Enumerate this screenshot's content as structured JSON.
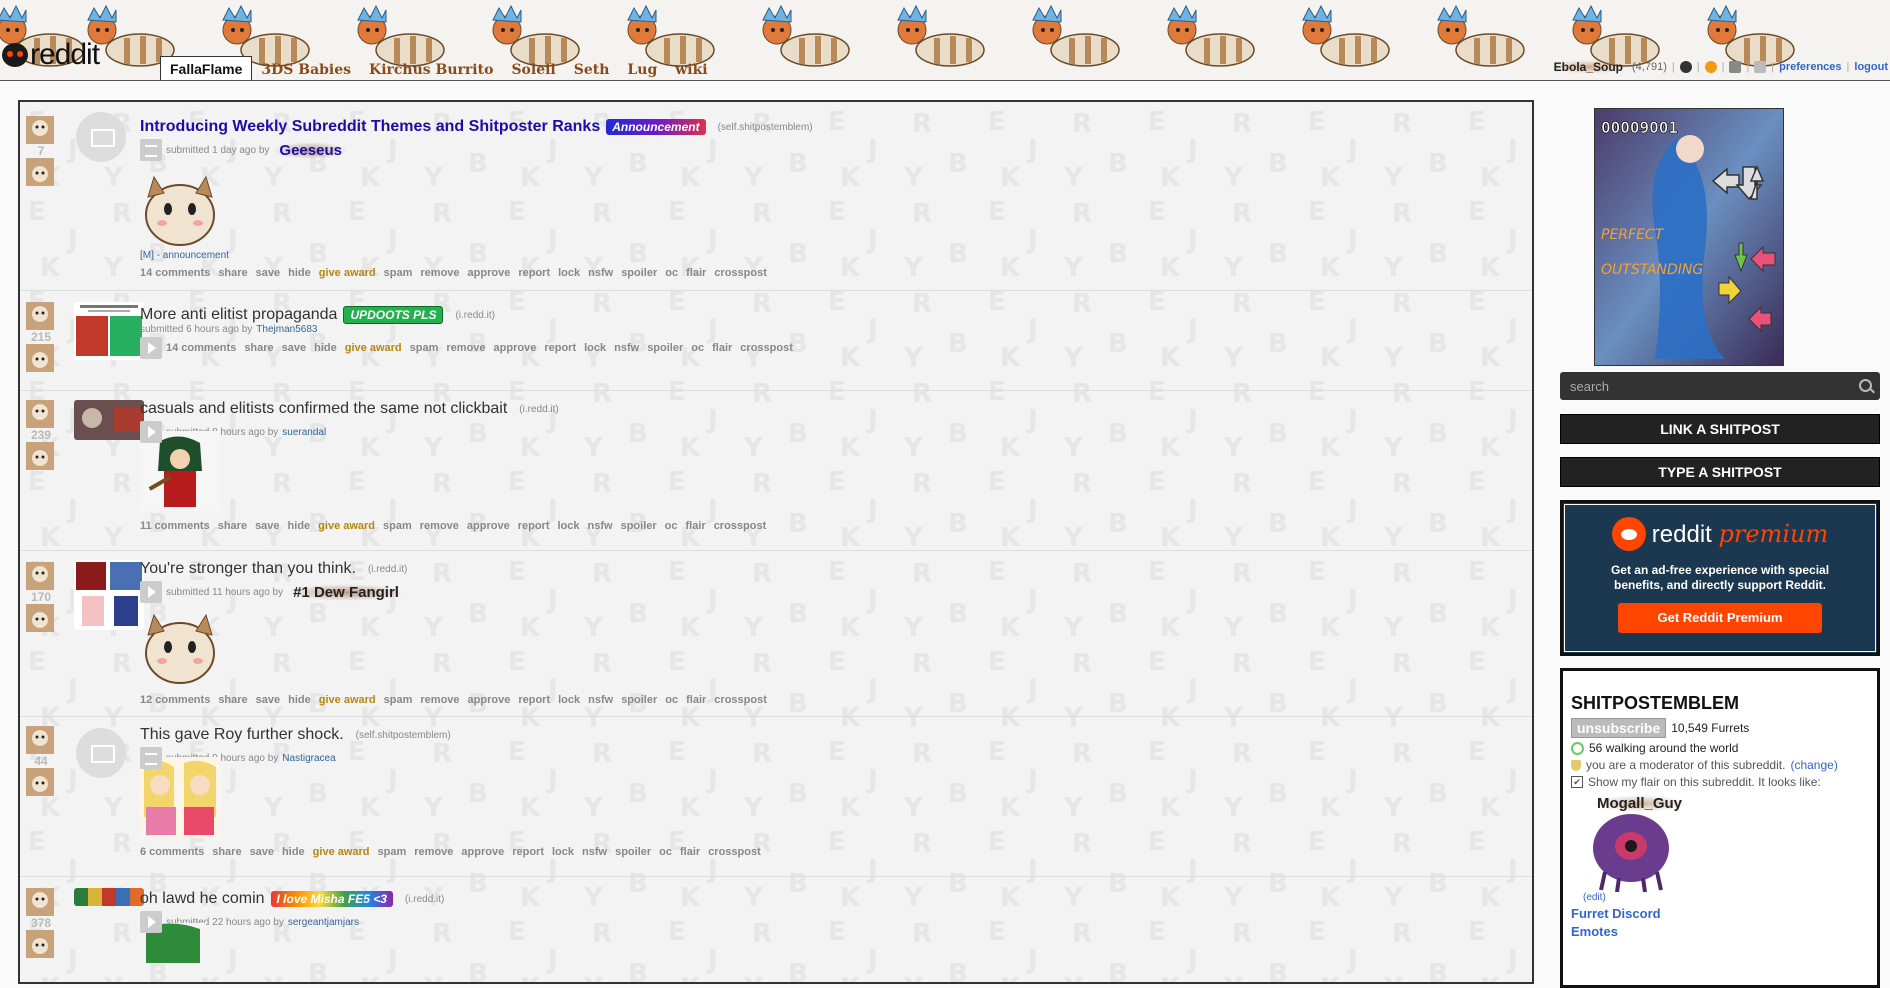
{
  "header": {
    "logo_text": "reddit",
    "tabs": [
      "FallaFlame",
      "3DS Babies",
      "Kirchus Burrito",
      "Soleil",
      "Seth",
      "Lug",
      "wiki"
    ],
    "user": {
      "name": "Ebola_Soup",
      "karma": "(4,791)",
      "preferences": "preferences",
      "logout": "logout"
    }
  },
  "posts": [
    {
      "score": "7",
      "title": "Introducing Weekly Subreddit Themes and Shitposter Ranks",
      "flair": "Announcement",
      "domain": "(self.shitpostemblem)",
      "submitted": "submitted 1 day ago by",
      "author": "Geeseus",
      "link_flair": "[M] - announcement",
      "comments": "14 comments"
    },
    {
      "score": "215",
      "title": "More anti elitist propaganda",
      "flair": "UPDOOTS PLS",
      "domain": "(i.redd.it)",
      "submitted": "submitted 6 hours ago by",
      "author": "Thejman5683",
      "comments": "14 comments"
    },
    {
      "score": "239",
      "title": "casuals and elitists confirmed the same not clickbait",
      "domain": "(i.redd.it)",
      "submitted": "submitted 8 hours ago by",
      "author": "suerandal",
      "comments": "11 comments"
    },
    {
      "score": "170",
      "title": "You're stronger than you think.",
      "domain": "(i.redd.it)",
      "submitted": "submitted 11 hours ago by",
      "author": "#1 Dew Fangirl",
      "comments": "12 comments"
    },
    {
      "score": "44",
      "title": "This gave Roy further shock.",
      "domain": "(self.shitpostemblem)",
      "submitted": "submitted 9 hours ago by",
      "author": "Nastigracea",
      "comments": "6 comments"
    },
    {
      "score": "378",
      "title": "oh lawd he comin",
      "flair": "I love Misha FE5 <3",
      "domain": "(i.redd.it)",
      "submitted": "submitted 22 hours ago by",
      "author": "sergeantjamjars"
    }
  ],
  "actions": {
    "share": "share",
    "save": "save",
    "hide": "hide",
    "give_award": "give award",
    "spam": "spam",
    "remove": "remove",
    "approve": "approve",
    "report": "report",
    "lock": "lock",
    "nsfw": "nsfw",
    "spoiler": "spoiler",
    "oc": "oc",
    "flair": "flair",
    "crosspost": "crosspost"
  },
  "sidebar": {
    "snapshot_score": "00009001",
    "snapshot_perfect": "PERFECT",
    "snapshot_outstanding": "OUTSTANDING",
    "search_placeholder": "search",
    "link_button": "LINK A SHITPOST",
    "type_button": "TYPE A SHITPOST",
    "premium": {
      "brand_left": "reddit",
      "brand_right": "premium",
      "desc": "Get an ad-free experience with special benefits, and directly support Reddit.",
      "button": "Get Reddit Premium"
    },
    "sub": {
      "name": "SHITPOSTEMBLEM",
      "unsubscribe": "unsubscribe",
      "members": "10,549 Furrets",
      "online": "56 walking around the world",
      "moderator": "you are a moderator of this subreddit.",
      "change": "(change)",
      "show_flair": "Show my flair on this subreddit. It looks like:",
      "flair_name": "Mogall_Guy",
      "edit": "(edit)",
      "link1": "Furret Discord",
      "link2": "Emotes"
    }
  },
  "colors": {
    "announce_flair": "#3a2fd6",
    "updoots_flair": "#22b14c",
    "premium_orange": "#ff4500",
    "premium_bg": "#1c3750"
  }
}
